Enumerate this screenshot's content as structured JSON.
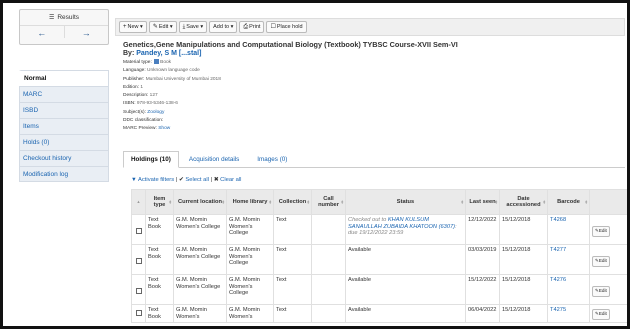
{
  "sidebar": {
    "results_label": "Results",
    "prev_glyph": "←",
    "next_glyph": "→",
    "menu": [
      {
        "label": "Normal",
        "active": true
      },
      {
        "label": "MARC"
      },
      {
        "label": "ISBD"
      },
      {
        "label": "Items"
      },
      {
        "label": "Holds (0)"
      },
      {
        "label": "Checkout history"
      },
      {
        "label": "Modification log"
      }
    ]
  },
  "toolbar": {
    "new": "New",
    "edit": "Edit",
    "save": "Save",
    "add_to": "Add to",
    "print": "Print",
    "place_hold": "Place hold"
  },
  "record": {
    "title": "Genetics,Gene Manipulations and Computational Biology (Textbook) TYBSC Course-XVII Sem-VI",
    "author_prefix": "By:",
    "author": "Pandey, S M [...stal]",
    "material_type_label": "Material type:",
    "material_type": "Book",
    "language_label": "Language:",
    "language": "Unknown language code",
    "publisher_label": "Publisher:",
    "publisher": "Mumbai University of Mumbai 2018",
    "edition_label": "Edition:",
    "edition": "1",
    "description_label": "Description:",
    "description": "127",
    "isbn_label": "ISBN:",
    "isbn": "978-93-5346-138-6",
    "subjects_label": "Subject(s):",
    "subjects": "Zoology",
    "ddc_label": "DDC classification:",
    "ddc": "",
    "marc_label": "MARC Preview:",
    "marc": "Show"
  },
  "tabs": {
    "holdings": "Holdings (10)",
    "acquisition": "Acquisition details",
    "images": "Images (0)"
  },
  "filters": {
    "activate": "Activate filters",
    "select_all": "Select all",
    "clear_all": "Clear all"
  },
  "table": {
    "headers": [
      "Item type",
      "Current location",
      "Home library",
      "Collection",
      "Call number",
      "Status",
      "Last seen",
      "Date accessioned",
      "Barcode"
    ],
    "edit_label": "Edit",
    "rows": [
      {
        "item_type": "Text Book",
        "current_location": "G.M. Momin Women's College",
        "home_library": "G.M. Momin Women's College",
        "collection": "Text",
        "call_number": "",
        "status_prefix": "Checked out to",
        "status_name": "KHAN KULSUM SANAULLAH ZUBAIDA KHATOON (6307)",
        "status_due": ": due 19/12/2022 23:59",
        "last_seen": "12/12/2022",
        "date_accessioned": "15/12/2018",
        "barcode": "T4268"
      },
      {
        "item_type": "Text Book",
        "current_location": "G.M. Momin Women's College",
        "home_library": "G.M. Momin Women's College",
        "collection": "Text",
        "call_number": "",
        "status": "Available",
        "last_seen": "03/03/2019",
        "date_accessioned": "15/12/2018",
        "barcode": "T4277"
      },
      {
        "item_type": "Text Book",
        "current_location": "G.M. Momin Women's College",
        "home_library": "G.M. Momin Women's College",
        "collection": "Text",
        "call_number": "",
        "status": "Available",
        "last_seen": "15/12/2022",
        "date_accessioned": "15/12/2018",
        "barcode": "T4276"
      },
      {
        "item_type": "Text Book",
        "current_location": "G.M. Momin Women's",
        "home_library": "G.M. Momin Women's",
        "collection": "Text",
        "call_number": "",
        "status": "Available",
        "last_seen": "06/04/2022",
        "date_accessioned": "15/12/2018",
        "barcode": "T4275"
      }
    ]
  }
}
